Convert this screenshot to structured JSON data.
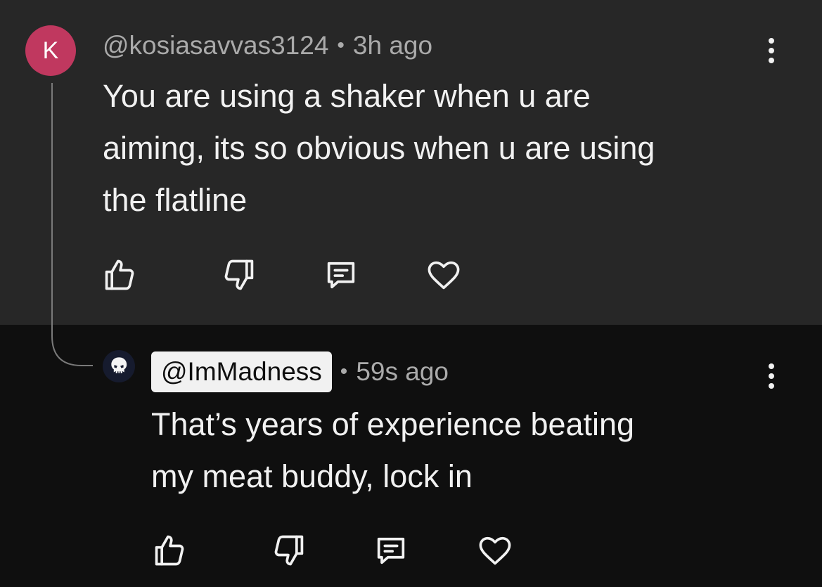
{
  "comment": {
    "avatar_letter": "K",
    "avatar_color": "#c0385f",
    "handle": "@kosiasavvas3124",
    "separator": "•",
    "time": "3h ago",
    "text_lines": [
      "You are using a shaker when u are",
      "aiming, its so obvious when u are using",
      "the flatline"
    ],
    "actions": [
      "like-icon",
      "dislike-icon",
      "reply-icon",
      "heart-icon"
    ],
    "menu_icon": "more-vertical-icon"
  },
  "reply": {
    "avatar_icon": "skull-icon",
    "handle": "@ImMadness",
    "separator": "•",
    "time": "59s ago",
    "text_lines": [
      "That’s years of experience beating",
      "my meat buddy, lock in"
    ],
    "actions": [
      "like-icon",
      "dislike-icon",
      "reply-icon",
      "heart-icon"
    ],
    "menu_icon": "more-vertical-icon"
  },
  "colors": {
    "top_background": "#272727",
    "reply_background": "#0f0f0f",
    "text_primary": "#f1f1f1",
    "text_secondary": "#aaaaaa"
  }
}
